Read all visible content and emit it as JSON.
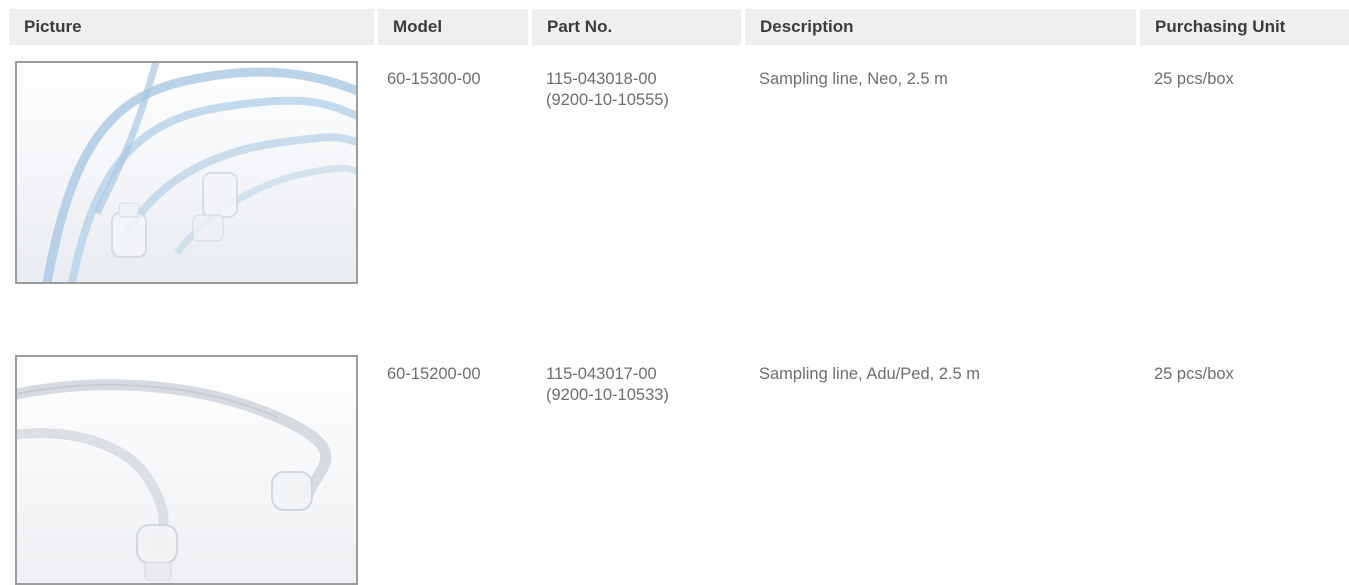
{
  "headers": {
    "picture": "Picture",
    "model": "Model",
    "part_no": "Part No.",
    "description": "Description",
    "purchasing_unit": "Purchasing Unit"
  },
  "rows": [
    {
      "model": "60-15300-00",
      "part_no_line1": "115-043018-00",
      "part_no_line2": "(9200-10-10555)",
      "description": "Sampling line, Neo, 2.5 m",
      "purchasing_unit": "25 pcs/box",
      "picture_icon": "blue-sampling-line-photo"
    },
    {
      "model": "60-15200-00",
      "part_no_line1": "115-043017-00",
      "part_no_line2": "(9200-10-10533)",
      "description": "Sampling line, Adu/Ped, 2.5 m",
      "purchasing_unit": "25 pcs/box",
      "picture_icon": "clear-sampling-line-photo"
    }
  ]
}
